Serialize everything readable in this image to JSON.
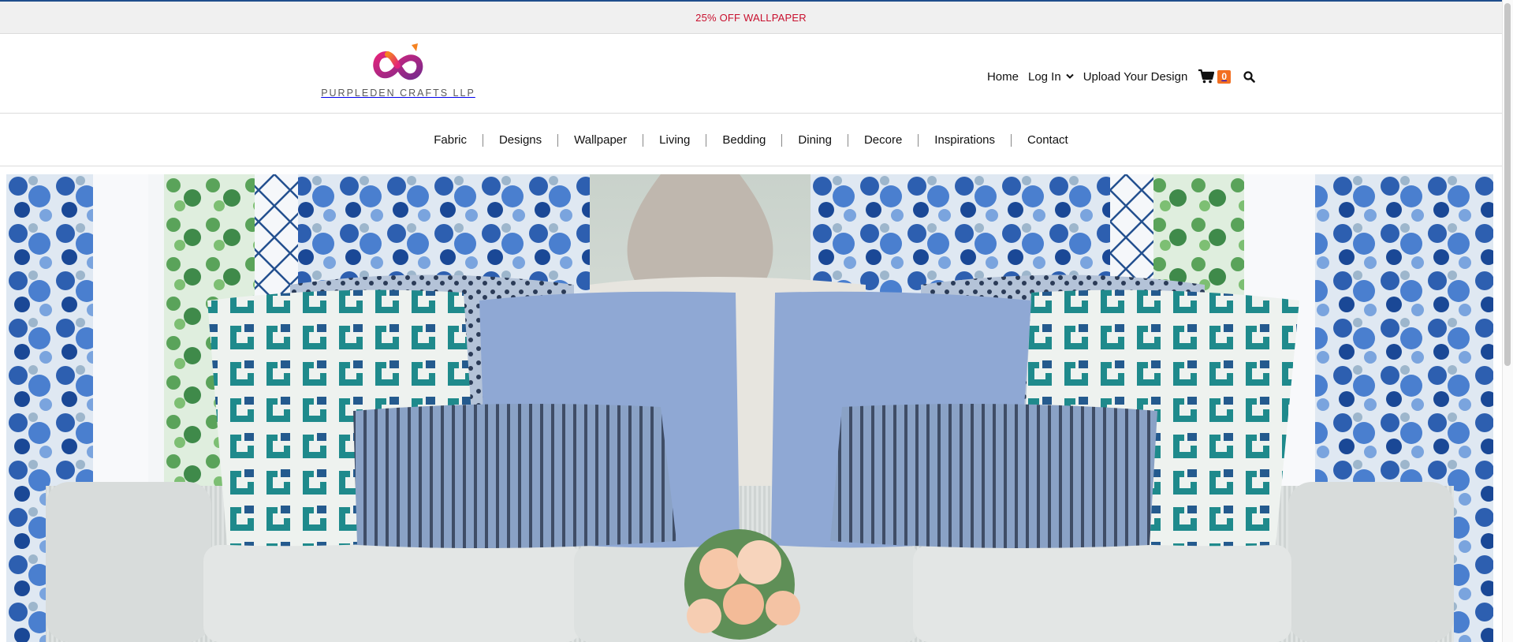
{
  "promo": {
    "text": "25% OFF WALLPAPER"
  },
  "brand": {
    "name": "PURPLEDEN CRAFTS LLP",
    "logo_icon": "infinity-logo-icon"
  },
  "util_nav": {
    "home": "Home",
    "login": "Log In",
    "upload": "Upload Your Design",
    "cart_count": "0"
  },
  "main_nav": [
    "Fabric",
    "Designs",
    "Wallpaper",
    "Living",
    "Bedding",
    "Dining",
    "Decore",
    "Inspirations",
    "Contact"
  ],
  "colors": {
    "promo_text": "#c8102e",
    "cart_badge": "#f26f21",
    "accent_border": "#1f4e8c"
  }
}
